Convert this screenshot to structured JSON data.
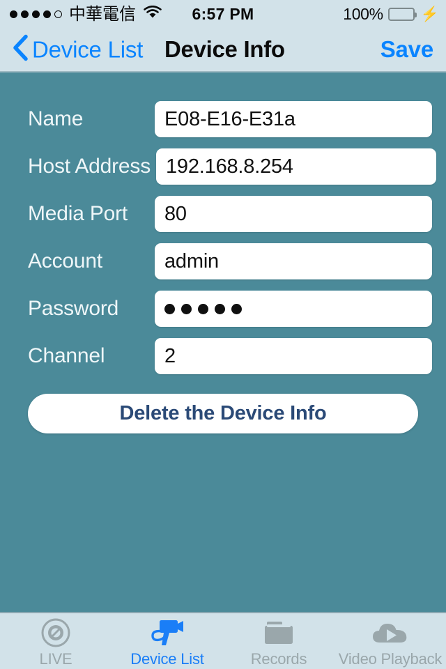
{
  "status_bar": {
    "signal_dots_filled": 4,
    "signal_dots_total": 5,
    "carrier": "中華電信",
    "wifi_icon": "wifi-icon",
    "time": "6:57 PM",
    "battery_percent": "100%",
    "battery_level": 100,
    "charging_icon": "⚡",
    "battery_color": "#4cd964",
    "background": "#d2e2e9"
  },
  "nav_bar": {
    "back_icon": "chevron-left-icon",
    "back_label": "Device List",
    "title": "Device Info",
    "action_label": "Save",
    "accent_color": "#0a84ff",
    "background": "#d2e2e9"
  },
  "content": {
    "background": "#4b8a99",
    "fields": [
      {
        "label": "Name",
        "value": "E08-E16-E31a",
        "type": "text",
        "placeholder": ""
      },
      {
        "label": "Host Address",
        "value": "192.168.8.254",
        "type": "text",
        "placeholder": ""
      },
      {
        "label": "Media Port",
        "value": "80",
        "type": "number",
        "placeholder": ""
      },
      {
        "label": "Account",
        "value": "admin",
        "type": "text",
        "placeholder": ""
      },
      {
        "label": "Password",
        "value": "•••••",
        "type": "password",
        "placeholder": "",
        "masked_length": 5
      },
      {
        "label": "Channel",
        "value": "2",
        "type": "number",
        "placeholder": ""
      }
    ],
    "delete_button_label": "Delete the Device Info",
    "delete_button_text_color": "#2b4a77"
  },
  "tab_bar": {
    "background": "#d2e2e9",
    "active_color": "#1a7ef7",
    "inactive_color": "#9aa7ab",
    "active_index": 1,
    "items": [
      {
        "label": "LIVE",
        "icon": "camera-lens-icon"
      },
      {
        "label": "Device List",
        "icon": "video-camera-icon"
      },
      {
        "label": "Records",
        "icon": "folder-icon"
      },
      {
        "label": "Video Playback",
        "icon": "cloud-play-icon"
      }
    ]
  }
}
